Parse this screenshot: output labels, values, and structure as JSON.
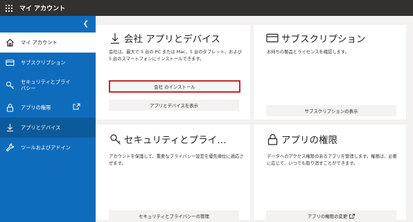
{
  "app": {
    "title": "マイ アカウント"
  },
  "sidebar": {
    "items": [
      {
        "label": "マイ アカウント",
        "icon": "home-icon"
      },
      {
        "label": "サブスクリプション",
        "icon": "card-icon"
      },
      {
        "label": "セキュリティとプライバシー",
        "icon": "key-icon"
      },
      {
        "label": "アプリの権限",
        "icon": "lock-icon"
      },
      {
        "label": "アプリとデバイス",
        "icon": "download-icon"
      },
      {
        "label": "ツールおよびアドイン",
        "icon": "wrench-icon"
      }
    ]
  },
  "cards": {
    "apps": {
      "title": "会社 アプリとデバイス",
      "desc": "会社は、最大で 5 台の PC または Mac、5 台のタブレット、および 5 台のスマートフォンにインストールできます。",
      "install_button": "会社 のインストール",
      "view_button": "アプリとデバイスを表示"
    },
    "subscriptions": {
      "title": "サブスクリプション",
      "desc": "お持ちの製品とライセンスを確認します。",
      "button": "サブスクリプションの表示"
    },
    "security": {
      "title": "セキュリティとプライ…",
      "desc": "アカウントを保護して、重要なプライバシー設定を優先順位に適応させます。",
      "button": "セキュリティとプライバシーの管理"
    },
    "permissions": {
      "title": "アプリの権限",
      "desc": "データへのアクセス権限のあるアプリを管理します。権限は、必要に応じて、いつでも取り消すことができます。",
      "button": "アプリの権限の変更"
    }
  },
  "colors": {
    "accent": "#0f6cbd",
    "topbar": "#323130",
    "highlight": "#c4262e"
  }
}
